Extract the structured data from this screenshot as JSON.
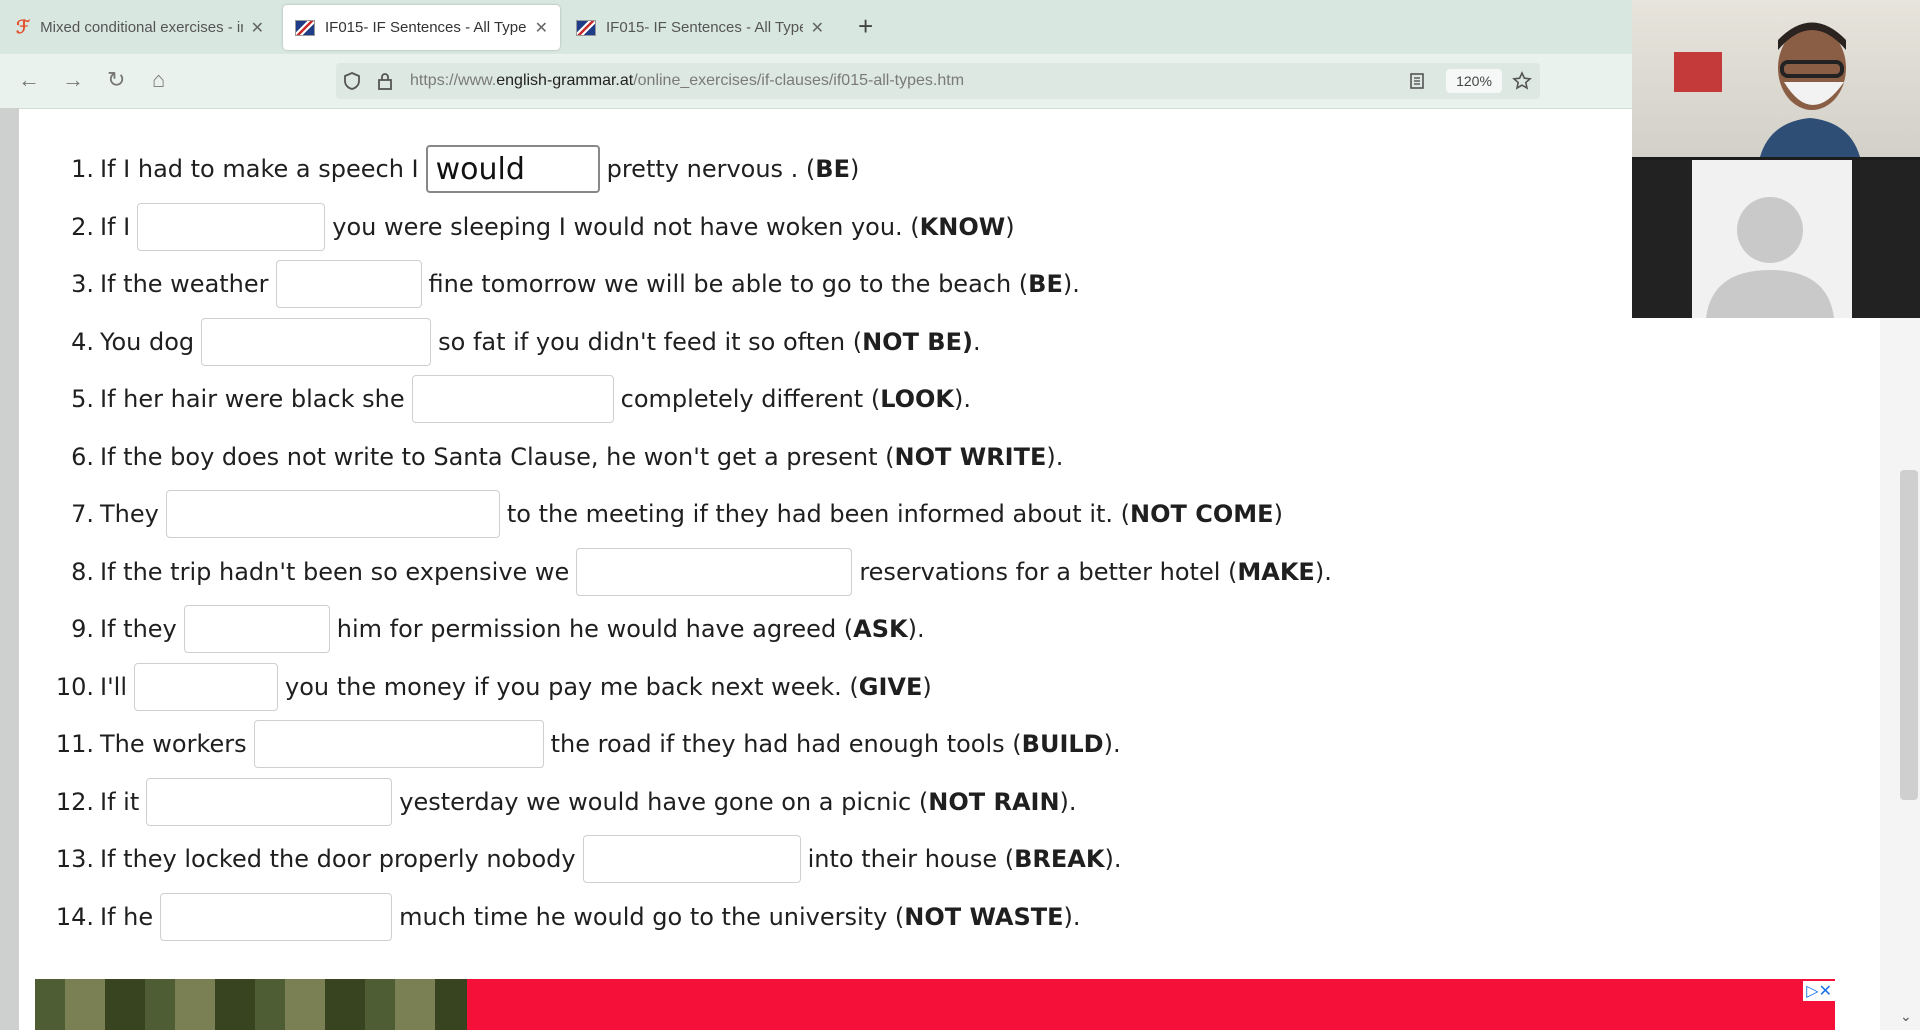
{
  "browser": {
    "tabs": [
      {
        "title": "Mixed conditional exercises - in",
        "icon": "tutor-logo-icon",
        "active": false
      },
      {
        "title": "IF015- IF Sentences - All Types",
        "icon": "uk-flag-icon",
        "active": true
      },
      {
        "title": "IF015- IF Sentences - All Types",
        "icon": "uk-flag-icon",
        "active": false
      }
    ],
    "new_tab": "+",
    "url_prefix": "https://www.",
    "url_domain": "english-grammar.at",
    "url_path": "/online_exercises/if-clauses/if015-all-types.htm",
    "zoom": "120%"
  },
  "exercises": [
    {
      "num": "1.",
      "before": "If I had to make a speech I",
      "value": "would ",
      "after": "pretty nervous . (",
      "hint": "BE",
      "end": ")"
    },
    {
      "num": "2.",
      "before": "If I",
      "value": "",
      "after": "you were sleeping I would not have woken you. (",
      "hint": "KNOW",
      "end": ")"
    },
    {
      "num": "3.",
      "before": "If the weather",
      "value": "",
      "after": "fine tomorrow we will be able to go to the beach (",
      "hint": "BE",
      "end": ")."
    },
    {
      "num": "4.",
      "before": "You dog",
      "value": "",
      "after": "so fat if you didn't feed it so often (",
      "hint": "NOT BE)",
      "end": "."
    },
    {
      "num": "5.",
      "before": "If her hair were black she",
      "value": "",
      "after": "completely different (",
      "hint": "LOOK",
      "end": ")."
    },
    {
      "num": "6.",
      "before": "If the boy does not write to Santa Clause, he won't get a present (",
      "hint": "NOT WRITE",
      "end": ")."
    },
    {
      "num": "7.",
      "before": "They",
      "value": "",
      "after": "to the meeting if they had been informed about it. (",
      "hint": "NOT COME",
      "end": ")"
    },
    {
      "num": "8.",
      "before": "If the trip hadn't been so expensive we",
      "value": "",
      "after": "reservations for a better hotel (",
      "hint": "MAKE",
      "end": ")."
    },
    {
      "num": "9.",
      "before": "If they",
      "value": "",
      "after": "him for permission he would have agreed (",
      "hint": "ASK",
      "end": ")."
    },
    {
      "num": "10.",
      "before": "I'll",
      "value": "",
      "after": "you the money if you pay me back next week. (",
      "hint": "GIVE",
      "end": ")"
    },
    {
      "num": "11.",
      "before": "The workers",
      "value": "",
      "after": "the road if they had had enough tools (",
      "hint": "BUILD",
      "end": ")."
    },
    {
      "num": "12.",
      "before": "If it",
      "value": "",
      "after": "yesterday we would have gone on a picnic (",
      "hint": "NOT RAIN",
      "end": ")."
    },
    {
      "num": "13.",
      "before": "If they locked the door properly nobody",
      "value": "",
      "after": "into their house (",
      "hint": "BREAK",
      "end": ")."
    },
    {
      "num": "14.",
      "before": "If he",
      "value": "",
      "after": "much time he would go to the university (",
      "hint": "NOT WASTE",
      "end": ")."
    }
  ],
  "ad": {
    "controls": "▷✕"
  },
  "colors": {
    "tabbar": "#d9e7e1",
    "ad_red": "#f5103a"
  }
}
